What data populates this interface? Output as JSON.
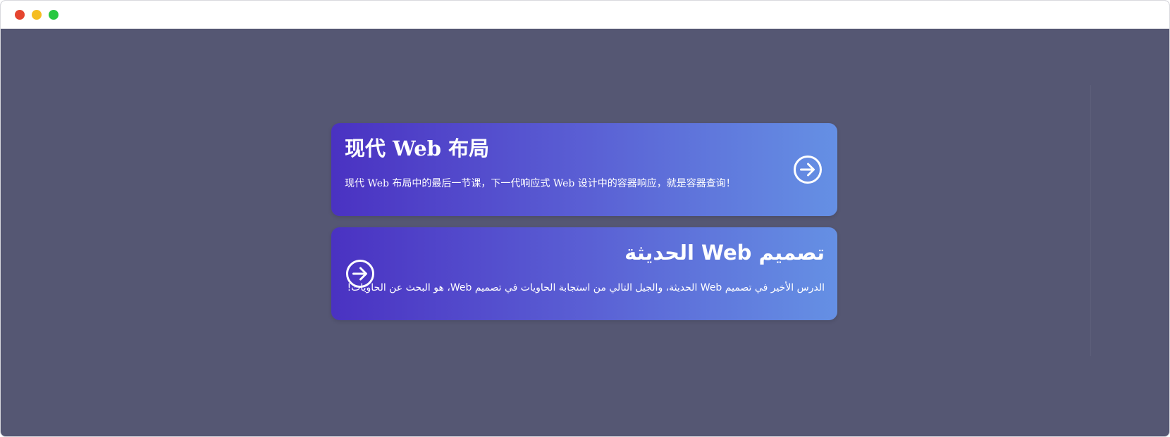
{
  "window": {
    "controls": [
      {
        "name": "close",
        "color": "#e5452f"
      },
      {
        "name": "minimize",
        "color": "#f5bd22"
      },
      {
        "name": "maximize",
        "color": "#28c840"
      }
    ]
  },
  "colors": {
    "background": "#555773",
    "card_gradient_start": "#4a32c2",
    "card_gradient_end": "#6590e4",
    "text": "#ffffff"
  },
  "cards": [
    {
      "title": "现代 Web 布局",
      "text": "现代 Web 布局中的最后一节课，下一代响应式 Web 设计中的容器响应，就是容器查询！",
      "icon": "arrow-right-circle-icon"
    },
    {
      "title": "تصميم Web الحديثة",
      "text": "الدرس الأخير في تصميم Web الحديثة، والجيل التالي من استجابة الحاويات في تصميم Web، هو البحث عن الحاويات!",
      "icon": "arrow-right-circle-icon"
    }
  ]
}
